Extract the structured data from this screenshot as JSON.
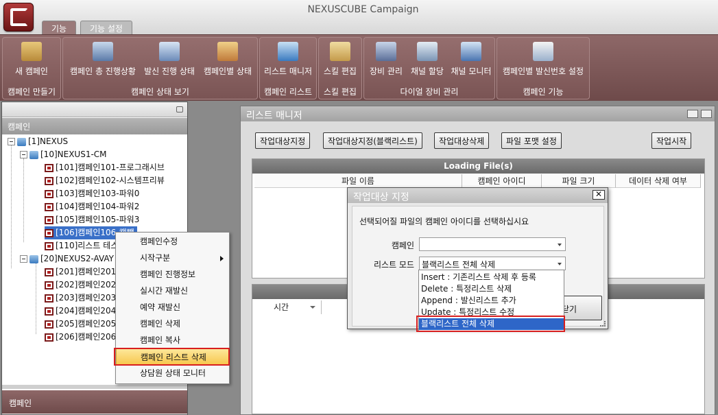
{
  "app": {
    "title": "NEXUSCUBE Campaign",
    "tabs": [
      "기능",
      "기능 설정"
    ]
  },
  "ribbon": {
    "groups": [
      {
        "label": "캠페인 만들기",
        "buttons": [
          {
            "label": "새 캠페인",
            "icon": "new-campaign-icon"
          }
        ]
      },
      {
        "label": "캠페인 상태 보기",
        "buttons": [
          {
            "label": "캠페인 총 진행상황",
            "icon": "campaign-progress-icon"
          },
          {
            "label": "발신 진행 상태",
            "icon": "dial-status-icon"
          },
          {
            "label": "캠페인별 상태",
            "icon": "campaign-status-icon"
          }
        ]
      },
      {
        "label": "캠페인 리스트",
        "buttons": [
          {
            "label": "리스트 매니저",
            "icon": "list-manager-icon"
          }
        ]
      },
      {
        "label": "스킬 편집",
        "buttons": [
          {
            "label": "스킬 편집",
            "icon": "skill-edit-icon"
          }
        ]
      },
      {
        "label": "다이얼 장비 관리",
        "buttons": [
          {
            "label": "장비 관리",
            "icon": "equipment-icon"
          },
          {
            "label": "채널 할당",
            "icon": "channel-assign-icon"
          },
          {
            "label": "채널 모니터",
            "icon": "channel-monitor-icon"
          }
        ]
      },
      {
        "label": "캠페인 기능",
        "buttons": [
          {
            "label": "캠페인별 발신번호 설정",
            "icon": "caller-id-settings-icon"
          }
        ]
      }
    ]
  },
  "left_panel": {
    "header": "캠페인",
    "footer": "캠페인",
    "tree": [
      "[1]NEXUS",
      "[10]NEXUS1-CM",
      "[101]캠페인101-프로그래시브",
      "[102]캠페인102-시스템프리뷰",
      "[103]캠페인103-파워0",
      "[104]캠페인104-파워2",
      "[105]캠페인105-파워3",
      "[106]캠페인106-캠빽",
      "[110]리스트 테스",
      "[20]NEXUS2-AVAY",
      "[201]캠페인201",
      "[202]캠페인202",
      "[203]캠페인203",
      "[204]캠페인204",
      "[205]캠페인205",
      "[206]캠페인206"
    ]
  },
  "context_menu": {
    "items": [
      "캠페인수정",
      "시작구분",
      "캠페인 진행정보",
      "실시간 재발신",
      "예약 재발신",
      "캠페인 삭제",
      "캠페인 복사",
      "캠페인 리스트 삭제",
      "상담원 상태 모니터"
    ],
    "highlighted": "캠페인 리스트 삭제"
  },
  "list_manager": {
    "title": "리스트 매니저",
    "buttons": [
      "작업대상지정",
      "작업대상지정(블랙리스트)",
      "작업대상삭제",
      "파일 포맷 설정",
      "작업시작"
    ],
    "files_header": "Loading File(s)",
    "columns": [
      "파일 이름",
      "캠페인 아이디",
      "파일 크기",
      "데이터 삭제 여부"
    ],
    "log_column": "시간"
  },
  "dialog": {
    "title": "작업대상 지정",
    "message": "선택되어질 파일의 캠페인 아이디를 선택하십시요",
    "campaign_label": "캠페인",
    "campaign_value": "",
    "mode_label": "리스트 모드",
    "mode_value": "블랙리스트 전체 삭제",
    "close_button": "닫기",
    "mode_options": [
      "Insert : 기존리스트 삭제 후 등록",
      "Delete : 특정리스트 삭제",
      "Append : 발신리스트 추가",
      "Update : 특정리스트 수정",
      "블랙리스트 전체 삭제"
    ],
    "selected_option": "블랙리스트 전체 삭제"
  },
  "colors": {
    "ribbon": "#7e5a5a",
    "selection": "#2e66c8",
    "highlight_box": "#d81e1e",
    "menu_highlight": "#f7c84f"
  }
}
